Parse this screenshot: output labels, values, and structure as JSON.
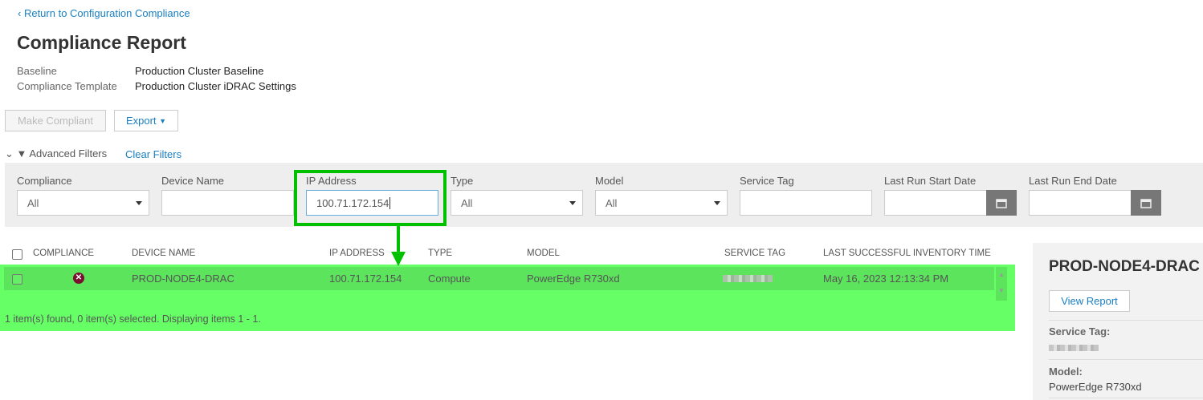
{
  "nav": {
    "back_link": "Return to Configuration Compliance"
  },
  "header": {
    "title": "Compliance Report",
    "baseline_label": "Baseline",
    "baseline_value": "Production Cluster Baseline",
    "template_label": "Compliance Template",
    "template_value": "Production Cluster iDRAC Settings"
  },
  "toolbar": {
    "make_compliant": "Make Compliant",
    "export": "Export"
  },
  "filters": {
    "toggle": "Advanced Filters",
    "clear": "Clear Filters",
    "compliance_label": "Compliance",
    "compliance_value": "All",
    "device_name_label": "Device Name",
    "device_name_value": "",
    "ip_label": "IP Address",
    "ip_value": "100.71.172.154",
    "type_label": "Type",
    "type_value": "All",
    "model_label": "Model",
    "model_value": "All",
    "service_tag_label": "Service Tag",
    "service_tag_value": "",
    "start_label": "Last Run Start Date",
    "end_label": "Last Run End Date"
  },
  "table": {
    "headers": [
      "COMPLIANCE",
      "DEVICE NAME",
      "IP ADDRESS",
      "TYPE",
      "MODEL",
      "SERVICE TAG",
      "LAST SUCCESSFUL INVENTORY TIME"
    ],
    "rows": [
      {
        "device": "PROD-NODE4-DRAC",
        "ip": "100.71.172.154",
        "type": "Compute",
        "model": "PowerEdge R730xd",
        "time": "May 16, 2023 12:13:34 PM"
      }
    ],
    "footer": "1 item(s) found, 0 item(s) selected. Displaying items 1 - 1."
  },
  "detail": {
    "title": "PROD-NODE4-DRAC",
    "view_report": "View Report",
    "service_tag_label": "Service Tag:",
    "model_label": "Model:",
    "model_value": "PowerEdge R730xd"
  },
  "colors": {
    "highlight": "#66ff66",
    "annotation": "#00c000",
    "error": "#7a1030"
  }
}
